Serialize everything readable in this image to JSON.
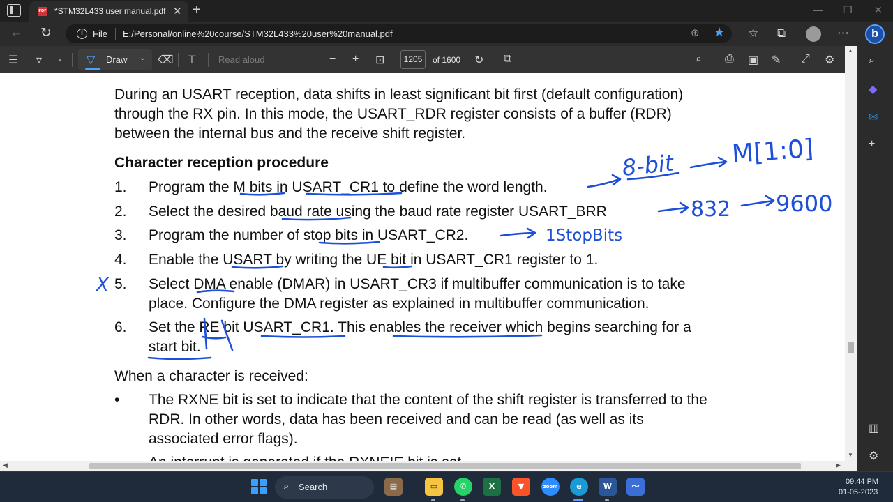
{
  "browser": {
    "tab_title": "*STM32L433 user manual.pdf",
    "pdf_badge": "PDF",
    "address_prefix": "File",
    "url": "E:/Personal/online%20course/STM32L433%20user%20manual.pdf",
    "copilot_label": "b"
  },
  "pdf_toolbar": {
    "draw_label": "Draw",
    "read_aloud_label": "Read aloud",
    "current_page": "1205",
    "page_total": "of 1600"
  },
  "document": {
    "intro": [
      "During an USART reception, data shifts in least significant bit first (default configuration)",
      "through the RX pin. In this mode, the USART_RDR register consists of a buffer (RDR)",
      "between the internal bus and the receive shift register."
    ],
    "heading": "Character reception procedure",
    "steps": [
      {
        "num": "1.",
        "lines": [
          "Program the M bits in USART_CR1 to define the word length."
        ]
      },
      {
        "num": "2.",
        "lines": [
          "Select the desired baud rate using the baud rate register USART_BRR"
        ]
      },
      {
        "num": "3.",
        "lines": [
          "Program the number of stop bits in USART_CR2."
        ]
      },
      {
        "num": "4.",
        "lines": [
          "Enable the USART by writing the UE bit in USART_CR1 register to 1."
        ]
      },
      {
        "num": "5.",
        "lines": [
          "Select DMA enable (DMAR) in USART_CR3 if multibuffer communication is to take",
          "place. Configure the DMA register as explained in multibuffer communication."
        ]
      },
      {
        "num": "6.",
        "lines": [
          "Set the RE bit USART_CR1. This enables the receiver which begins searching for a",
          "start bit."
        ]
      }
    ],
    "received_heading": "When a character is received:",
    "bullets": [
      {
        "symbol": "•",
        "lines": [
          "The RXNE bit is set to indicate that the content of the shift register is transferred to the",
          "RDR. In other words, data has been received and can be read (as well as its",
          "associated error flags)."
        ]
      }
    ],
    "cut_off_line": "An interrupt is generated if the RXNEIE bit is set."
  },
  "annotations": {
    "word_length": "8-bit",
    "m_field": "M[1:0]",
    "baud_value": "832",
    "baud_rate": "9600",
    "stop_bits": "1StopBits",
    "skip_mark": "X"
  },
  "taskbar": {
    "search_label": "Search",
    "time": "09:44 PM",
    "date": "01-05-2023",
    "apps": [
      "file-explorer",
      "whatsapp",
      "excel",
      "brave",
      "zoom",
      "edge",
      "word",
      "stocks"
    ]
  }
}
